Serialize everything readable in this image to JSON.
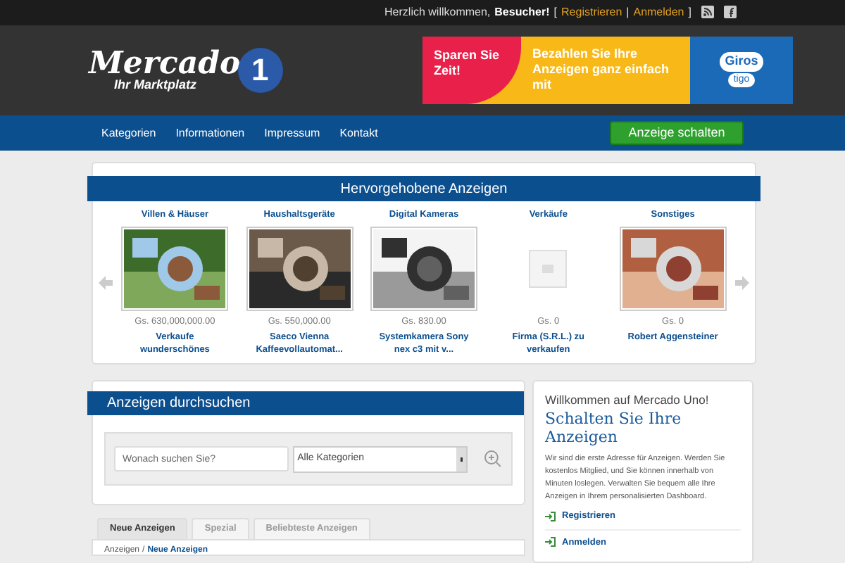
{
  "top_bar": {
    "greeting": "Herzlich willkommen,",
    "user": "Besucher!",
    "open_bracket": "[",
    "links": [
      "Registrieren",
      "Anmelden"
    ],
    "separator": "|",
    "close_bracket": "]"
  },
  "logo": {
    "name": "Mercado",
    "tagline": "Ihr Marktplatz",
    "number": "1"
  },
  "banner": {
    "left": "Sparen Sie Zeit!",
    "middle": "Bezahlen Sie Ihre Anzeigen ganz einfach mit",
    "brand": "Giros",
    "sub_brand": "tigo"
  },
  "nav": {
    "items": [
      "Kategorien",
      "Informationen",
      "Impressum",
      "Kontakt"
    ],
    "cta": "Anzeige schalten"
  },
  "featured": {
    "title": "Hervorgehobene Anzeigen",
    "items": [
      {
        "category": "Villen & Häuser",
        "kind": "picture",
        "price": "Gs. 630,000,000.00",
        "title": "Verkaufe wunderschönes"
      },
      {
        "category": "Haushaltsgeräte",
        "kind": "picture",
        "price": "Gs. 550,000.00",
        "title": "Saeco Vienna Kaffeevollautomat..."
      },
      {
        "category": "Digital Kameras",
        "kind": "picture",
        "price": "Gs. 830.00",
        "title": "Systemkamera Sony nex c3 mit v..."
      },
      {
        "category": "Verkäufe",
        "kind": "placeholder",
        "price": "Gs. 0",
        "title": "Firma (S.R.L.) zu verkaufen"
      },
      {
        "category": "Sonstiges",
        "kind": "picture",
        "price": "Gs. 0",
        "title": "Robert Aggensteiner"
      }
    ]
  },
  "search": {
    "title": "Anzeigen durchsuchen",
    "placeholder": "Wonach suchen Sie?",
    "category": "Alle Kategorien"
  },
  "tabs": [
    {
      "label": "Neue Anzeigen",
      "selected": true
    },
    {
      "label": "Spezial",
      "selected": false
    },
    {
      "label": "Beliebteste Anzeigen",
      "selected": false
    }
  ],
  "breadcrumb": {
    "root": "Anzeigen",
    "separator": "/",
    "current": "Neue Anzeigen"
  },
  "welcome": {
    "heading": "Willkommen auf Mercado Uno!",
    "title": "Schalten Sie Ihre Anzeigen",
    "text": "Wir sind die erste Adresse für Anzeigen. Werden Sie kostenlos Mitglied, und Sie können innerhalb von Minuten loslegen. Verwalten Sie bequem alle Ihre Anzeigen in Ihrem personalisierten Dashboard.",
    "links": [
      "Registrieren",
      "Anmelden"
    ]
  }
}
